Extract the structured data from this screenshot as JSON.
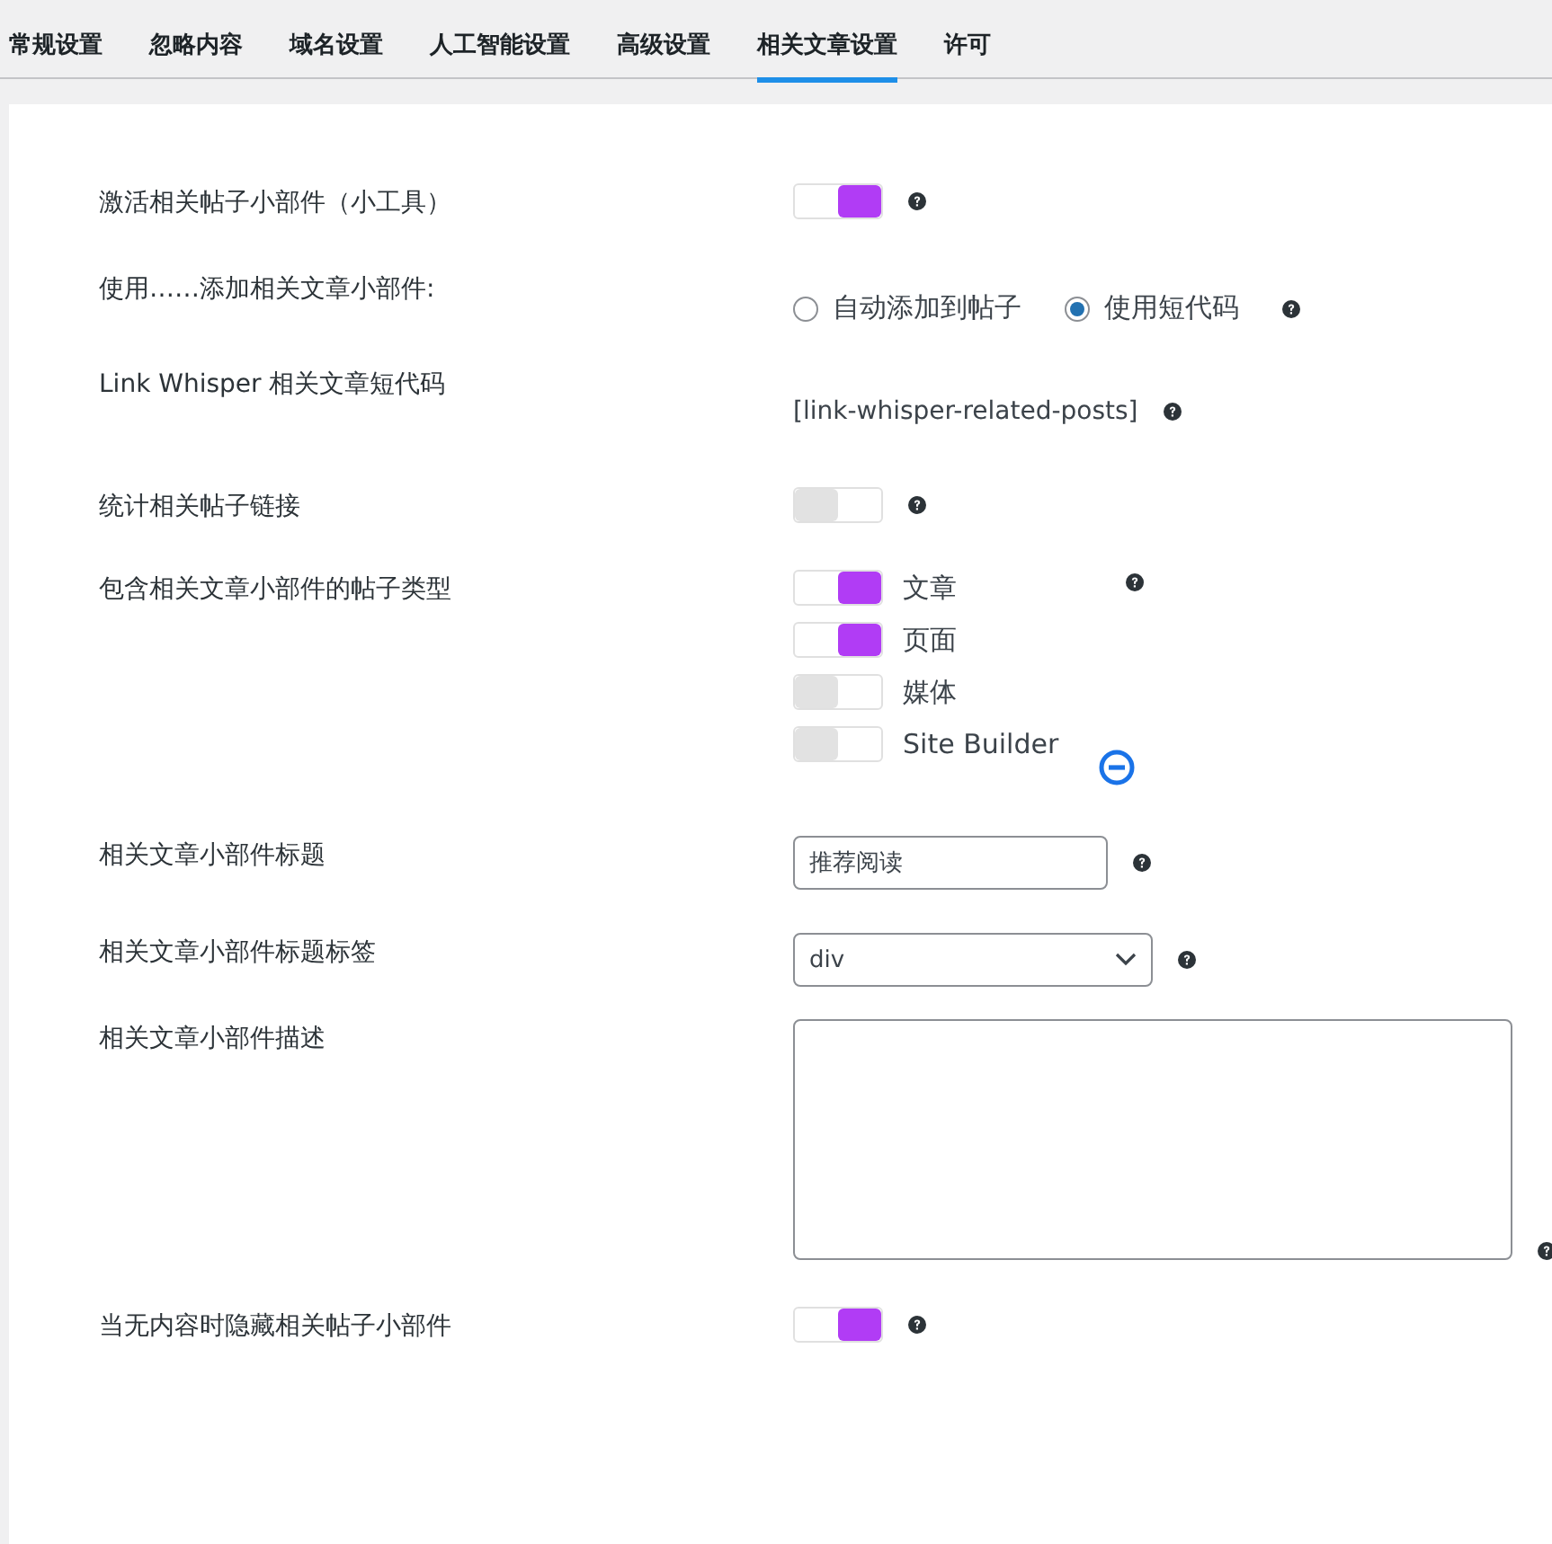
{
  "tabs": [
    {
      "label": "常规设置",
      "selected": false
    },
    {
      "label": "忽略内容",
      "selected": false
    },
    {
      "label": "域名设置",
      "selected": false
    },
    {
      "label": "人工智能设置",
      "selected": false
    },
    {
      "label": "高级设置",
      "selected": false
    },
    {
      "label": "相关文章设置",
      "selected": true
    },
    {
      "label": "许可",
      "selected": false
    }
  ],
  "settings": [
    {
      "label": "激活相关帖子小部件（小工具）",
      "kind": "toggle",
      "on": true
    },
    {
      "label": "使用……添加相关文章小部件:",
      "kind": "radio",
      "options": [
        {
          "label": "自动添加到帖子",
          "selected": false
        },
        {
          "label": "使用短代码",
          "selected": true
        }
      ]
    },
    {
      "label": "Link Whisper 相关文章短代码",
      "kind": "text",
      "value": "[link-whisper-related-posts]"
    },
    {
      "label": "统计相关帖子链接",
      "kind": "toggle",
      "on": false
    },
    {
      "label": "包含相关文章小部件的帖子类型",
      "kind": "checklist",
      "items": [
        {
          "label": "文章",
          "on": true
        },
        {
          "label": "页面",
          "on": true
        },
        {
          "label": "媒体",
          "on": false
        },
        {
          "label": "Site Builder",
          "on": false
        }
      ]
    },
    {
      "label": "相关文章小部件标题",
      "kind": "input",
      "value": "推荐阅读"
    },
    {
      "label": "相关文章小部件标题标签",
      "kind": "select",
      "value": "div"
    },
    {
      "label": "相关文章小部件描述",
      "kind": "textarea"
    },
    {
      "label": "当无内容时隐藏相关帖子小部件",
      "kind": "toggle",
      "on": true
    }
  ]
}
